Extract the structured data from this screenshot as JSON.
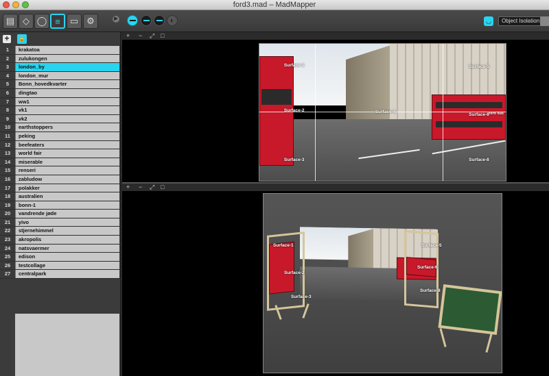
{
  "window": {
    "title": "ford3.mad – MadMapper"
  },
  "toolbar": {
    "object_isolation_label": "Object Isolation",
    "left_buttons": [
      "media-icon",
      "surfaces-icon",
      "light-icon",
      "list-icon",
      "projector-icon",
      "settings-icon"
    ],
    "mode_buttons": [
      "mode-1-icon",
      "mode-2-icon",
      "mode-3-icon",
      "mode-4-icon"
    ]
  },
  "sidebar": {
    "items": [
      {
        "num": "1",
        "label": "krakatoa"
      },
      {
        "num": "2",
        "label": "zulukongen"
      },
      {
        "num": "3",
        "label": "london_by"
      },
      {
        "num": "4",
        "label": "london_mur"
      },
      {
        "num": "5",
        "label": "Bonn_hovedkvarter"
      },
      {
        "num": "6",
        "label": "dingtao"
      },
      {
        "num": "7",
        "label": "ww1"
      },
      {
        "num": "8",
        "label": "vk1"
      },
      {
        "num": "9",
        "label": "vk2"
      },
      {
        "num": "10",
        "label": "earthstoppers"
      },
      {
        "num": "11",
        "label": "peking"
      },
      {
        "num": "12",
        "label": "beefeaters"
      },
      {
        "num": "13",
        "label": "world fair"
      },
      {
        "num": "14",
        "label": "miserable"
      },
      {
        "num": "15",
        "label": "renseri"
      },
      {
        "num": "16",
        "label": "zabludow"
      },
      {
        "num": "17",
        "label": "polakker"
      },
      {
        "num": "18",
        "label": "australien"
      },
      {
        "num": "19",
        "label": "bonn-1"
      },
      {
        "num": "20",
        "label": "vandrende jøde"
      },
      {
        "num": "21",
        "label": "yivo"
      },
      {
        "num": "22",
        "label": "stjernehimmel"
      },
      {
        "num": "23",
        "label": "akropolis"
      },
      {
        "num": "24",
        "label": "natsvaermer"
      },
      {
        "num": "25",
        "label": "edison"
      },
      {
        "num": "26",
        "label": "testcollage"
      },
      {
        "num": "27",
        "label": "centralpark"
      }
    ],
    "selected_index": 2
  },
  "panels": {
    "top_bar": [
      "+",
      "−",
      "⤢",
      "□"
    ],
    "bottom_bar": [
      "+",
      "−",
      "⤢",
      "□"
    ]
  },
  "surfaces_top": [
    "Surface-1",
    "Surface-2",
    "Surface-3",
    "Surface-4",
    "Surface-5",
    "Surface-6",
    "Surface-8"
  ],
  "surfaces_bottom": [
    "Surface-1",
    "Surface-2",
    "Surface-3",
    "Surface-5",
    "Surface-6",
    "Surface-8"
  ],
  "photo_text": {
    "bus_sign": "zero sus"
  },
  "colors": {
    "accent": "#2ad4f0",
    "bus_red": "#c8192a"
  }
}
